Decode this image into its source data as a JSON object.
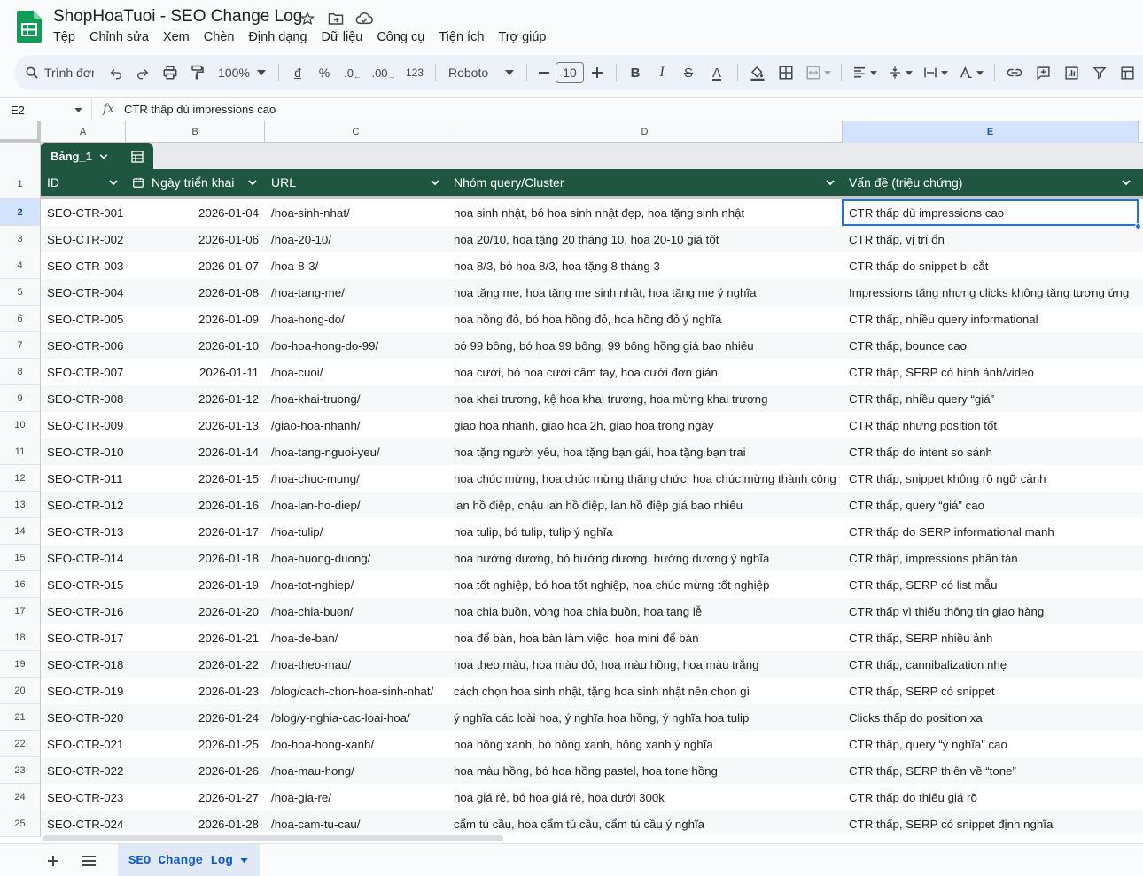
{
  "app": {
    "doc_title": "ShopHoaTuoi - SEO Change Log",
    "menu": [
      "Tệp",
      "Chỉnh sửa",
      "Xem",
      "Chèn",
      "Định dạng",
      "Dữ liệu",
      "Công cụ",
      "Tiện ích",
      "Trợ giúp"
    ]
  },
  "toolbar": {
    "search_label": "Trình đơn",
    "zoom": "100%",
    "currency": "đ",
    "percent": "%",
    "dec_decrease": ".0",
    "dec_increase": ".00",
    "format_123": "123",
    "font": "Roboto",
    "font_size": "10",
    "bold": "B",
    "italic": "I",
    "strike": "S",
    "text_color": "A"
  },
  "formula_bar": {
    "cell_ref": "E2",
    "fx": "fx",
    "value": "CTR thấp dù impressions cao"
  },
  "columns": [
    "A",
    "B",
    "C",
    "D",
    "E"
  ],
  "table": {
    "name": "Bảng_1",
    "headers": [
      "ID",
      "Ngày triển khai",
      "URL",
      "Nhóm query/Cluster",
      "Vấn đề (triệu chứng)"
    ],
    "header_row_number": "1",
    "rows": [
      {
        "n": "2",
        "id": "SEO-CTR-001",
        "date": "2026-01-04",
        "url": "/hoa-sinh-nhat/",
        "query": "hoa sinh nhật, bó hoa sinh nhật đẹp, hoa tặng sinh nhật",
        "issue": "CTR thấp dù impressions cao"
      },
      {
        "n": "3",
        "id": "SEO-CTR-002",
        "date": "2026-01-06",
        "url": "/hoa-20-10/",
        "query": "hoa 20/10, hoa tặng 20 tháng 10, hoa 20-10 giá tốt",
        "issue": "CTR thấp, vị trí ổn"
      },
      {
        "n": "4",
        "id": "SEO-CTR-003",
        "date": "2026-01-07",
        "url": "/hoa-8-3/",
        "query": "hoa 8/3, bó hoa 8/3, hoa tặng 8 tháng 3",
        "issue": "CTR thấp do snippet bị cắt"
      },
      {
        "n": "5",
        "id": "SEO-CTR-004",
        "date": "2026-01-08",
        "url": "/hoa-tang-me/",
        "query": "hoa tặng mẹ, hoa tặng mẹ sinh nhật, hoa tặng mẹ ý nghĩa",
        "issue": "Impressions tăng nhưng clicks không tăng tương ứng"
      },
      {
        "n": "6",
        "id": "SEO-CTR-005",
        "date": "2026-01-09",
        "url": "/hoa-hong-do/",
        "query": "hoa hồng đỏ, bó hoa hồng đỏ, hoa hồng đỏ ý nghĩa",
        "issue": "CTR thấp, nhiều query informational"
      },
      {
        "n": "7",
        "id": "SEO-CTR-006",
        "date": "2026-01-10",
        "url": "/bo-hoa-hong-do-99/",
        "query": "bó 99 bông, bó hoa 99 bông, 99 bông hồng giá bao nhiêu",
        "issue": "CTR thấp, bounce cao"
      },
      {
        "n": "8",
        "id": "SEO-CTR-007",
        "date": "2026-01-11",
        "url": "/hoa-cuoi/",
        "query": "hoa cưới, bó hoa cưới cầm tay, hoa cưới đơn giản",
        "issue": "CTR thấp, SERP có hình ảnh/video"
      },
      {
        "n": "9",
        "id": "SEO-CTR-008",
        "date": "2026-01-12",
        "url": "/hoa-khai-truong/",
        "query": "hoa khai trương, kệ hoa khai trương, hoa mừng khai trương",
        "issue": "CTR thấp, nhiều query “giá”"
      },
      {
        "n": "10",
        "id": "SEO-CTR-009",
        "date": "2026-01-13",
        "url": "/giao-hoa-nhanh/",
        "query": "giao hoa nhanh, giao hoa 2h, giao hoa trong ngày",
        "issue": "CTR thấp nhưng position tốt"
      },
      {
        "n": "11",
        "id": "SEO-CTR-010",
        "date": "2026-01-14",
        "url": "/hoa-tang-nguoi-yeu/",
        "query": "hoa tặng người yêu, hoa tặng bạn gái, hoa tặng bạn trai",
        "issue": "CTR thấp do intent so sánh"
      },
      {
        "n": "12",
        "id": "SEO-CTR-011",
        "date": "2026-01-15",
        "url": "/hoa-chuc-mung/",
        "query": "hoa chúc mừng, hoa chúc mừng thăng chức, hoa chúc mừng thành công",
        "issue": "CTR thấp, snippet không rõ ngữ cảnh"
      },
      {
        "n": "13",
        "id": "SEO-CTR-012",
        "date": "2026-01-16",
        "url": "/hoa-lan-ho-diep/",
        "query": "lan hồ điệp, chậu lan hồ điệp, lan hồ điệp giá bao nhiêu",
        "issue": "CTR thấp, query “giá” cao"
      },
      {
        "n": "14",
        "id": "SEO-CTR-013",
        "date": "2026-01-17",
        "url": "/hoa-tulip/",
        "query": "hoa tulip, bó tulip, tulip ý nghĩa",
        "issue": "CTR thấp do SERP informational mạnh"
      },
      {
        "n": "15",
        "id": "SEO-CTR-014",
        "date": "2026-01-18",
        "url": "/hoa-huong-duong/",
        "query": "hoa hướng dương, bó hướng dương, hướng dương ý nghĩa",
        "issue": "CTR thấp, impressions phân tán"
      },
      {
        "n": "16",
        "id": "SEO-CTR-015",
        "date": "2026-01-19",
        "url": "/hoa-tot-nghiep/",
        "query": "hoa tốt nghiệp, bó hoa tốt nghiệp, hoa chúc mừng tốt nghiệp",
        "issue": "CTR thấp, SERP có list mẫu"
      },
      {
        "n": "17",
        "id": "SEO-CTR-016",
        "date": "2026-01-20",
        "url": "/hoa-chia-buon/",
        "query": "hoa chia buồn, vòng hoa chia buồn, hoa tang lễ",
        "issue": "CTR thấp vì thiếu thông tin giao hàng"
      },
      {
        "n": "18",
        "id": "SEO-CTR-017",
        "date": "2026-01-21",
        "url": "/hoa-de-ban/",
        "query": "hoa để bàn, hoa bàn làm việc, hoa mini để bàn",
        "issue": "CTR thấp, SERP nhiều ảnh"
      },
      {
        "n": "19",
        "id": "SEO-CTR-018",
        "date": "2026-01-22",
        "url": "/hoa-theo-mau/",
        "query": "hoa theo màu, hoa màu đỏ, hoa màu hồng, hoa màu trắng",
        "issue": "CTR thấp, cannibalization nhẹ"
      },
      {
        "n": "20",
        "id": "SEO-CTR-019",
        "date": "2026-01-23",
        "url": "/blog/cach-chon-hoa-sinh-nhat/",
        "query": "cách chọn hoa sinh nhật, tặng hoa sinh nhật nên chọn gì",
        "issue": "CTR thấp, SERP có snippet"
      },
      {
        "n": "21",
        "id": "SEO-CTR-020",
        "date": "2026-01-24",
        "url": "/blog/y-nghia-cac-loai-hoa/",
        "query": "ý nghĩa các loài hoa, ý nghĩa hoa hồng, ý nghĩa hoa tulip",
        "issue": "Clicks thấp do position xa"
      },
      {
        "n": "22",
        "id": "SEO-CTR-021",
        "date": "2026-01-25",
        "url": "/bo-hoa-hong-xanh/",
        "query": "hoa hồng xanh, bó hồng xanh, hồng xanh ý nghĩa",
        "issue": "CTR thấp, query “ý nghĩa” cao"
      },
      {
        "n": "23",
        "id": "SEO-CTR-022",
        "date": "2026-01-26",
        "url": "/hoa-mau-hong/",
        "query": "hoa màu hồng, bó hoa hồng pastel, hoa tone hồng",
        "issue": "CTR thấp, SERP thiên về “tone”"
      },
      {
        "n": "24",
        "id": "SEO-CTR-023",
        "date": "2026-01-27",
        "url": "/hoa-gia-re/",
        "query": "hoa giá rẻ, bó hoa giá rẻ, hoa dưới 300k",
        "issue": "CTR thấp do thiếu giá rõ"
      },
      {
        "n": "25",
        "id": "SEO-CTR-024",
        "date": "2026-01-28",
        "url": "/hoa-cam-tu-cau/",
        "query": "cẩm tú cầu, hoa cẩm tú cầu, cẩm tú cầu ý nghĩa",
        "issue": "CTR thấp, SERP có snippet định nghĩa"
      }
    ]
  },
  "sheet_tabs": {
    "active": "SEO Change Log"
  },
  "colors": {
    "table_header": "#1e5641",
    "selection": "#1a73e8",
    "toolbar_bg": "#edf2fa"
  },
  "selected_cell": "E2"
}
